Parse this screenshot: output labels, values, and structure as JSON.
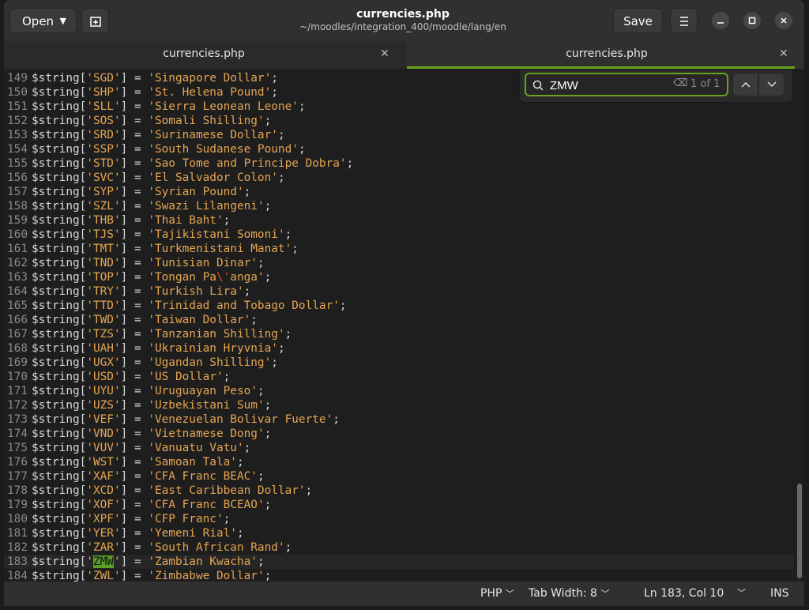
{
  "header": {
    "open_label": "Open",
    "save_label": "Save",
    "title": "currencies.php",
    "subtitle": "~/moodles/integration_400/moodle/lang/en"
  },
  "tabs": [
    {
      "label": "currencies.php"
    },
    {
      "label": "currencies.php"
    }
  ],
  "search": {
    "value": "ZMW",
    "match_count": "1 of 1"
  },
  "status": {
    "language": "PHP",
    "tab_width": "Tab Width: 8",
    "cursor": "Ln 183, Col 10",
    "mode": "INS"
  },
  "code_lines": [
    {
      "n": "149",
      "key": "SGD",
      "val": "Singapore Dollar"
    },
    {
      "n": "150",
      "key": "SHP",
      "val": "St. Helena Pound"
    },
    {
      "n": "151",
      "key": "SLL",
      "val": "Sierra Leonean Leone"
    },
    {
      "n": "152",
      "key": "SOS",
      "val": "Somali Shilling"
    },
    {
      "n": "153",
      "key": "SRD",
      "val": "Surinamese Dollar"
    },
    {
      "n": "154",
      "key": "SSP",
      "val": "South Sudanese Pound"
    },
    {
      "n": "155",
      "key": "STD",
      "val": "Sao Tome and Principe Dobra"
    },
    {
      "n": "156",
      "key": "SVC",
      "val": "El Salvador Colon"
    },
    {
      "n": "157",
      "key": "SYP",
      "val": "Syrian Pound"
    },
    {
      "n": "158",
      "key": "SZL",
      "val": "Swazi Lilangeni"
    },
    {
      "n": "159",
      "key": "THB",
      "val": "Thai Baht"
    },
    {
      "n": "160",
      "key": "TJS",
      "val": "Tajikistani Somoni"
    },
    {
      "n": "161",
      "key": "TMT",
      "val": "Turkmenistani Manat"
    },
    {
      "n": "162",
      "key": "TND",
      "val": "Tunisian Dinar"
    },
    {
      "n": "163",
      "key": "TOP",
      "val": "Tongan Pa\\'anga"
    },
    {
      "n": "164",
      "key": "TRY",
      "val": "Turkish Lira"
    },
    {
      "n": "165",
      "key": "TTD",
      "val": "Trinidad and Tobago Dollar"
    },
    {
      "n": "166",
      "key": "TWD",
      "val": "Taiwan Dollar"
    },
    {
      "n": "167",
      "key": "TZS",
      "val": "Tanzanian Shilling"
    },
    {
      "n": "168",
      "key": "UAH",
      "val": "Ukrainian Hryvnia"
    },
    {
      "n": "169",
      "key": "UGX",
      "val": "Ugandan Shilling"
    },
    {
      "n": "170",
      "key": "USD",
      "val": "US Dollar"
    },
    {
      "n": "171",
      "key": "UYU",
      "val": "Uruguayan Peso"
    },
    {
      "n": "172",
      "key": "UZS",
      "val": "Uzbekistani Sum"
    },
    {
      "n": "173",
      "key": "VEF",
      "val": "Venezuelan Bolivar Fuerte"
    },
    {
      "n": "174",
      "key": "VND",
      "val": "Vietnamese Dong"
    },
    {
      "n": "175",
      "key": "VUV",
      "val": "Vanuatu Vatu"
    },
    {
      "n": "176",
      "key": "WST",
      "val": "Samoan Tala"
    },
    {
      "n": "177",
      "key": "XAF",
      "val": "CFA Franc BEAC"
    },
    {
      "n": "178",
      "key": "XCD",
      "val": "East Caribbean Dollar"
    },
    {
      "n": "179",
      "key": "XOF",
      "val": "CFA Franc BCEAO"
    },
    {
      "n": "180",
      "key": "XPF",
      "val": "CFP Franc"
    },
    {
      "n": "181",
      "key": "YER",
      "val": "Yemeni Rial"
    },
    {
      "n": "182",
      "key": "ZAR",
      "val": "South African Rand"
    },
    {
      "n": "183",
      "key": "ZMW",
      "val": "Zambian Kwacha"
    },
    {
      "n": "184",
      "key": "ZWL",
      "val": "Zimbabwe Dollar"
    }
  ],
  "colors": {
    "accent": "#66a31d",
    "string": "#e5a552",
    "escape": "#e04b40"
  },
  "icons": {
    "newtab": "new-tab-icon",
    "menu": "hamburger-menu-icon",
    "search": "search-icon",
    "clear": "backspace-clear-icon"
  }
}
